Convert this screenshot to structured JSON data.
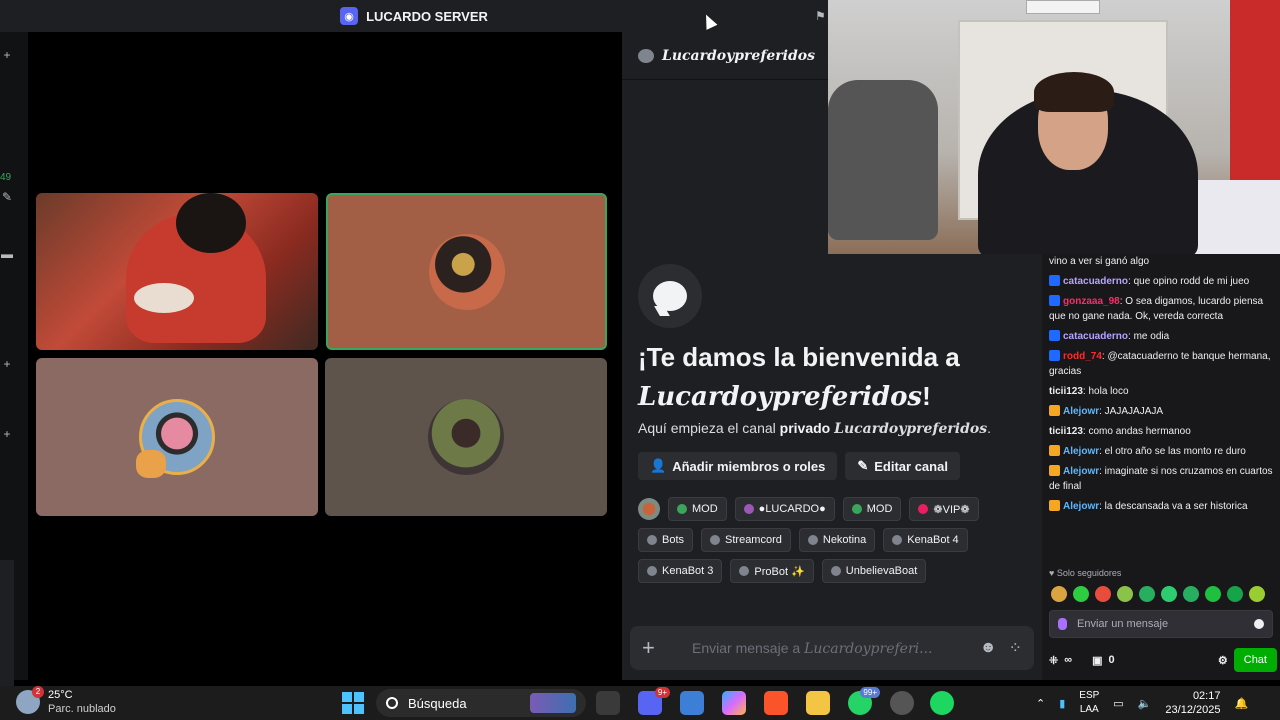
{
  "titlebar": {
    "server_name": "LUCARDO SERVER"
  },
  "leftstrip": {
    "count": "49"
  },
  "channel": {
    "name": "Lucardoypreferidos",
    "welcome_prefix": "¡Te damos la bienvenida a",
    "welcome_channel": "Lucardoypreferidos",
    "welcome_suffix": "!",
    "sub_prefix": "Aquí empieza el canal",
    "sub_bold": "privado",
    "sub_channel": "Lucardoypreferidos",
    "sub_suffix": ".",
    "add_members_label": "Añadir miembros o roles",
    "edit_channel_label": "Editar canal",
    "roles": [
      {
        "label": "MOD",
        "color": "#3ba55d"
      },
      {
        "label": "●LUCARDO●",
        "color": "#9b59b6"
      },
      {
        "label": "MOD",
        "color": "#3ba55d"
      },
      {
        "label": "❁VIP❁",
        "color": "#e91e63"
      },
      {
        "label": "Bots",
        "color": "#80848e"
      },
      {
        "label": "Streamcord",
        "color": "#80848e"
      },
      {
        "label": "Nekotina",
        "color": "#80848e"
      },
      {
        "label": "KenaBot 4",
        "color": "#80848e"
      },
      {
        "label": "KenaBot 3",
        "color": "#80848e"
      },
      {
        "label": "ProBot ✨",
        "color": "#80848e"
      },
      {
        "label": "UnbelievaBoat",
        "color": "#80848e"
      }
    ],
    "composer_prefix": "Enviar mensaje a",
    "composer_channel": "Lucardoypreferi..."
  },
  "chat": {
    "messages": [
      {
        "badge": "",
        "user": "",
        "user_color": "#efeff1",
        "text": "vino a ver si ganó algo"
      },
      {
        "badge": "b-blue",
        "user": "catacuaderno",
        "user_color": "#b6a3ff",
        "text": ": que opino rodd de mi jueo"
      },
      {
        "badge": "b-blue",
        "user": "gonzaaa_98",
        "user_color": "#ff2b6a",
        "text": ": O sea digamos, lucardo piensa que no gane nada. Ok, vereda correcta"
      },
      {
        "badge": "b-blue",
        "user": "catacuaderno",
        "user_color": "#b6a3ff",
        "text": ": me odia"
      },
      {
        "badge": "b-blue",
        "user": "rodd_74",
        "user_color": "#ff2b2b",
        "text": ": @catacuaderno te banque hermana, gracias"
      },
      {
        "badge": "",
        "user": "ticii123",
        "user_color": "#efeff1",
        "text": ": hola loco"
      },
      {
        "badge": "b-crown",
        "user": "Alejowr",
        "user_color": "#5cb8ff",
        "text": ": JAJAJAJAJA"
      },
      {
        "badge": "",
        "user": "ticii123",
        "user_color": "#efeff1",
        "text": ": como andas hermanoo"
      },
      {
        "badge": "b-crown",
        "user": "Alejowr",
        "user_color": "#5cb8ff",
        "text": ": el otro año se las monto re duro"
      },
      {
        "badge": "b-crown",
        "user": "Alejowr",
        "user_color": "#5cb8ff",
        "text": ": imaginate si nos cruzamos en cuartos de final"
      },
      {
        "badge": "b-crown",
        "user": "Alejowr",
        "user_color": "#5cb8ff",
        "text": ": la descansada va a ser historica"
      }
    ],
    "followers_label": "♥ Solo seguidores",
    "input_placeholder": "Enviar un mensaje",
    "viewers_label": "∞",
    "points_label": "0",
    "chat_button": "Chat"
  },
  "taskbar": {
    "temp": "25°C",
    "weather": "Parc. nublado",
    "weather_badge": "2",
    "search_label": "Búsqueda",
    "discord_badge": "9+",
    "whatsapp_badge": "99+",
    "lang_top": "ESP",
    "lang_bottom": "LAA",
    "time": "02:17",
    "date": "23/12/2025"
  }
}
